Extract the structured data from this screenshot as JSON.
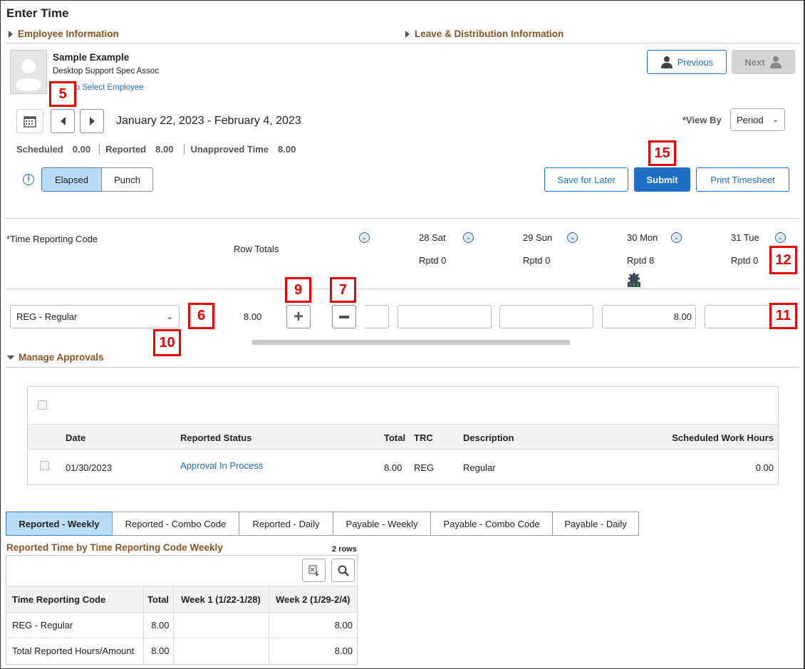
{
  "page_title": "Enter Time",
  "sections": {
    "employee_info": "Employee Information",
    "leave_info": "Leave & Distribution Information",
    "manage_approvals": "Manage Approvals"
  },
  "employee": {
    "name": "Sample Example",
    "title": "Desktop Support Spec Assoc",
    "select_link": "Return to Select Employee",
    "select_link_visible": "n to Select Employee"
  },
  "nav": {
    "previous": "Previous",
    "next": "Next"
  },
  "period": {
    "range": "January 22, 2023 - February 4, 2023",
    "view_by_label": "*View By",
    "view_by_value": "Period"
  },
  "summary": {
    "scheduled_label": "Scheduled",
    "scheduled": "0.00",
    "reported_label": "Reported",
    "reported": "8.00",
    "unapproved_label": "Unapproved Time",
    "unapproved": "8.00"
  },
  "mode": {
    "elapsed": "Elapsed",
    "punch": "Punch",
    "selected": "Elapsed"
  },
  "actions": {
    "save": "Save for Later",
    "submit": "Submit",
    "print": "Print Timesheet"
  },
  "grid": {
    "trc_header": "*Time Reporting Code",
    "row_totals": "Row Totals",
    "days": [
      {
        "label": "28 Sat",
        "rptd": "Rptd 0"
      },
      {
        "label": "29 Sun",
        "rptd": "Rptd 0"
      },
      {
        "label": "30 Mon",
        "rptd": "Rptd 8"
      },
      {
        "label": "31 Tue",
        "rptd": "Rptd 0"
      }
    ],
    "row": {
      "trc": "REG - Regular",
      "total": "8.00",
      "values": [
        "",
        "",
        "",
        "8.00",
        ""
      ]
    }
  },
  "callouts": [
    "5",
    "6",
    "7",
    "9",
    "10",
    "11",
    "12",
    "15"
  ],
  "approvals": {
    "headers": [
      "Date",
      "Reported Status",
      "Total",
      "TRC",
      "Description",
      "Scheduled Work Hours"
    ],
    "rows": [
      {
        "date": "01/30/2023",
        "status": "Approval In Process",
        "total": "8.00",
        "trc": "REG",
        "description": "Regular",
        "scheduled": "0.00"
      }
    ]
  },
  "tabs": [
    "Reported - Weekly",
    "Reported - Combo Code",
    "Reported - Daily",
    "Payable - Weekly",
    "Payable - Combo Code",
    "Payable - Daily"
  ],
  "weekly": {
    "title": "Reported Time by Time Reporting Code Weekly",
    "rows_count": "2 rows",
    "headers": [
      "Time Reporting Code",
      "Total",
      "Week 1 (1/22-1/28)",
      "Week 2 (1/29-2/4)"
    ],
    "rows": [
      [
        "REG - Regular",
        "8.00",
        "",
        "8.00"
      ],
      [
        "Total Reported Hours/Amount",
        "8.00",
        "",
        "8.00"
      ]
    ]
  },
  "colors": {
    "accent": "#1f6fc5",
    "section": "#8b5420",
    "callout": "#e00000",
    "tab_selected": "#b9dcf8"
  }
}
